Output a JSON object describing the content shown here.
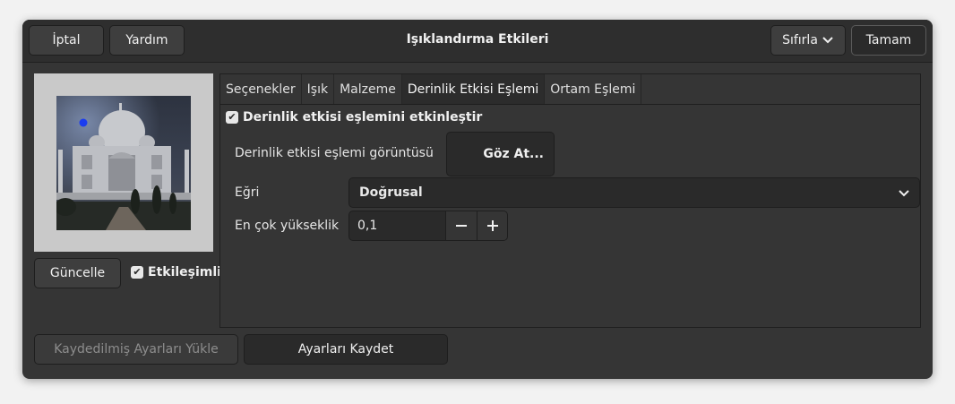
{
  "header": {
    "cancel_label": "İptal",
    "help_label": "Yardım",
    "title": "Işıklandırma Etkileri",
    "reset_label": "Sıfırla",
    "ok_label": "Tamam"
  },
  "preview": {
    "update_label": "Güncelle",
    "interactive_label": "Etkileşimli",
    "interactive_checked": true
  },
  "tabs": [
    {
      "label": "Seçenekler",
      "active": false
    },
    {
      "label": "Işık",
      "active": false
    },
    {
      "label": "Malzeme",
      "active": false
    },
    {
      "label": "Derinlik Etkisi Eşlemi",
      "active": true
    },
    {
      "label": "Ortam Eşlemi",
      "active": false
    }
  ],
  "bump": {
    "enable_label": "Derinlik etkisi eşlemini etkinleştir",
    "enable_checked": true,
    "image_label": "Derinlik etkisi eşlemi görüntüsü",
    "browse_label": "Göz At...",
    "curve_label": "Eğri",
    "curve_value": "Doğrusal",
    "max_height_label": "En çok yükseklik",
    "max_height_value": "0,1"
  },
  "footer": {
    "load_label": "Kaydedilmiş Ayarları Yükle",
    "save_label": "Ayarları Kaydet"
  },
  "colors": {
    "window_bg": "#353535",
    "headerbar_bg": "#2e2e2e",
    "light_point": "#1a3cf0"
  }
}
